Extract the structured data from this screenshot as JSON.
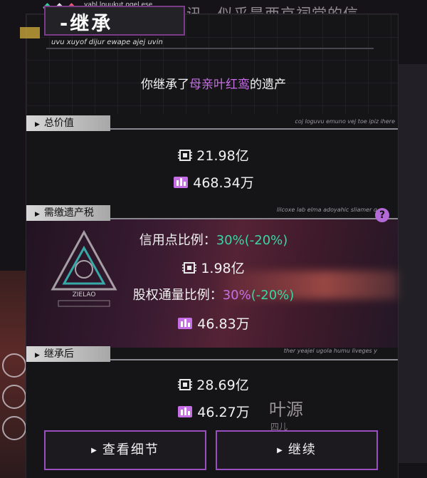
{
  "background": {
    "message_fragment": "讯，似乎是西京祠堂的信",
    "character_name": "叶源",
    "character_subtitle": "四儿"
  },
  "header": {
    "title": "-继承",
    "tagline_top": "yabl louukut ogel ese",
    "tagline_bottom": "uvu xuyof dijur ewape ajej uvin"
  },
  "inheritance_notice": {
    "prefix": "你继承了",
    "highlight": "母亲叶红鸾",
    "suffix": "的遗产"
  },
  "sections": {
    "total_value": {
      "label": "总价值",
      "note": "coj loguvu emuno vej toe ipiz ihere",
      "credits": "21.98亿",
      "equity": "468.34万"
    },
    "tax": {
      "label": "需缴遗产税",
      "note": "lilcoxe lab elma adoyahic sliamer q",
      "credit_ratio_label": "信用点比例：",
      "credit_ratio_value": "30%",
      "credit_ratio_delta": "(-20%)",
      "credits": "1.98亿",
      "equity_ratio_label": "股权通量比例：",
      "equity_ratio_value": "30%",
      "equity_ratio_delta": "(-20%)",
      "equity": "46.83万",
      "emblem_text": "ZIELAO"
    },
    "after": {
      "label": "继承后",
      "note": "ther yeajel ugola humu liveges y",
      "credits": "28.69亿",
      "equity": "46.27万"
    }
  },
  "buttons": {
    "details": "查看细节",
    "continue": "继续"
  },
  "colors": {
    "accent_purple": "#c56ee6",
    "delta_green": "#39d6a4",
    "button_border": "#9a4fc0"
  },
  "icons": {
    "credits": "credit-chip-icon",
    "equity": "equity-flux-icon",
    "help": "question-icon"
  }
}
